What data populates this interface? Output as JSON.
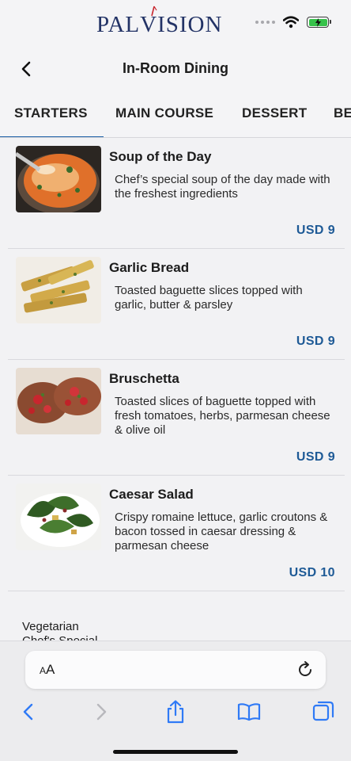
{
  "brand": {
    "prefix": "PAL",
    "v": "V",
    "suffix": "ISION"
  },
  "header": {
    "title": "In-Room Dining"
  },
  "tabs": [
    {
      "label": "STARTERS",
      "active": true
    },
    {
      "label": "MAIN COURSE",
      "active": false
    },
    {
      "label": "DESSERT",
      "active": false
    },
    {
      "label": "BE",
      "active": false
    }
  ],
  "menu_items": [
    {
      "name": "Soup of the Day",
      "description": "Chef’s special soup of the day made with the freshest ingredients",
      "price": "USD 9",
      "image": "soup-image"
    },
    {
      "name": "Garlic Bread",
      "description": "Toasted baguette slices topped with garlic, butter & parsley",
      "price": "USD 9",
      "image": "garlic-bread-image"
    },
    {
      "name": "Bruschetta",
      "description": "Toasted slices of baguette topped with fresh tomatoes, herbs, parmesan cheese & olive oil",
      "price": "USD 9",
      "image": "bruschetta-image"
    },
    {
      "name": "Caesar Salad",
      "description": "Crispy romaine lettuce, garlic croutons & bacon tossed in caesar dressing & parmesan cheese",
      "price": "USD 10",
      "image": "caesar-salad-image"
    }
  ],
  "footer_labels": {
    "line1": "Vegetarian",
    "line2": "Chef's Special"
  },
  "browser": {
    "text_size_small": "A",
    "text_size_large": "A"
  },
  "colors": {
    "accent": "#1b5ea6",
    "price": "#1e5a96",
    "brand": "#233366",
    "battery": "#36c24a"
  },
  "icons": [
    "back-chevron-icon",
    "wifi-icon",
    "battery-charging-icon",
    "reload-icon",
    "share-icon",
    "bookmarks-icon",
    "tabs-icon"
  ]
}
